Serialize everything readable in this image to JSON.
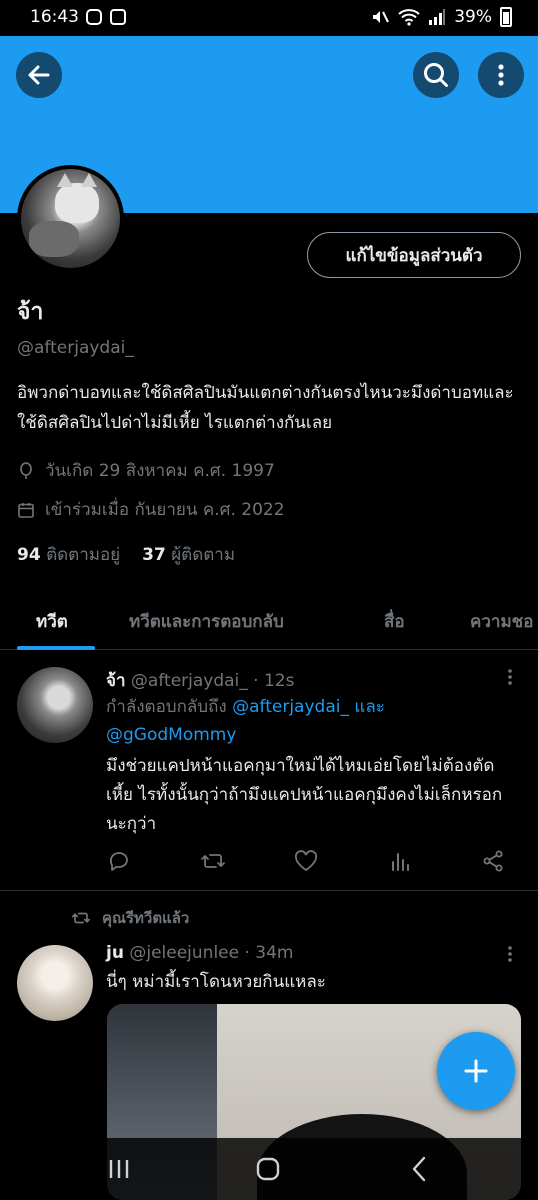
{
  "status_bar": {
    "time": "16:43",
    "battery": "39%"
  },
  "header": {
    "back_icon": "arrow-left-icon",
    "search_icon": "search-icon",
    "more_icon": "more-vertical-icon",
    "banner_color": "#1d9bf0"
  },
  "profile": {
    "name": "จ้า",
    "handle": "@afterjaydai_",
    "edit_label": "แก้ไขข้อมูลส่วนตัว",
    "bio": "อิพวกด่าบอทและใช้ดิสศิลปินมันแตกต่างกันตรงไหนวะมึงด่าบอทและใช้ดิสศิลปินไปด่าไม่มีเหี้ย ไรแตกต่างกันเลย",
    "birthday": "วันเกิด 29 สิงหาคม ค.ศ. 1997",
    "joined": "เข้าร่วมเมื่อ กันยายน ค.ศ. 2022",
    "following_count": "94",
    "following_label": "ติดตามอยู่",
    "followers_count": "37",
    "followers_label": "ผู้ติดตาม"
  },
  "tabs": [
    {
      "label": "ทวีต",
      "active": true
    },
    {
      "label": "ทวีตและการตอบกลับ",
      "active": false
    },
    {
      "label": "สื่อ",
      "active": false
    },
    {
      "label": "ความชอ",
      "active": false
    }
  ],
  "tweets": [
    {
      "name": "จ้า",
      "handle_time": "@afterjaydai_ · 12s",
      "reply_prefix": "กำลังตอบกลับถึง",
      "reply_user1": "@afterjaydai_",
      "reply_and": "และ",
      "reply_user2": "@gGodMommy",
      "text": "มึงช่วยแคปหน้าแอคกุมาใหม่ได้ไหมเอ่ยโดยไม่ต้องตัดเหี้ย ไรทั้งนั้นกุว่าถ้ามึงแคปหน้าแอคกุมึงคงไม่เล็กหรอกนะกุว่า"
    },
    {
      "retweeted_label": "คุณรีทวีตแล้ว",
      "name": "ju",
      "handle_time": "@jeleejunlee · 34m",
      "text": "นี่ๆ หม่ามี้เราโดนหวยกินแหละ"
    }
  ],
  "accent_color": "#1d9bf0"
}
